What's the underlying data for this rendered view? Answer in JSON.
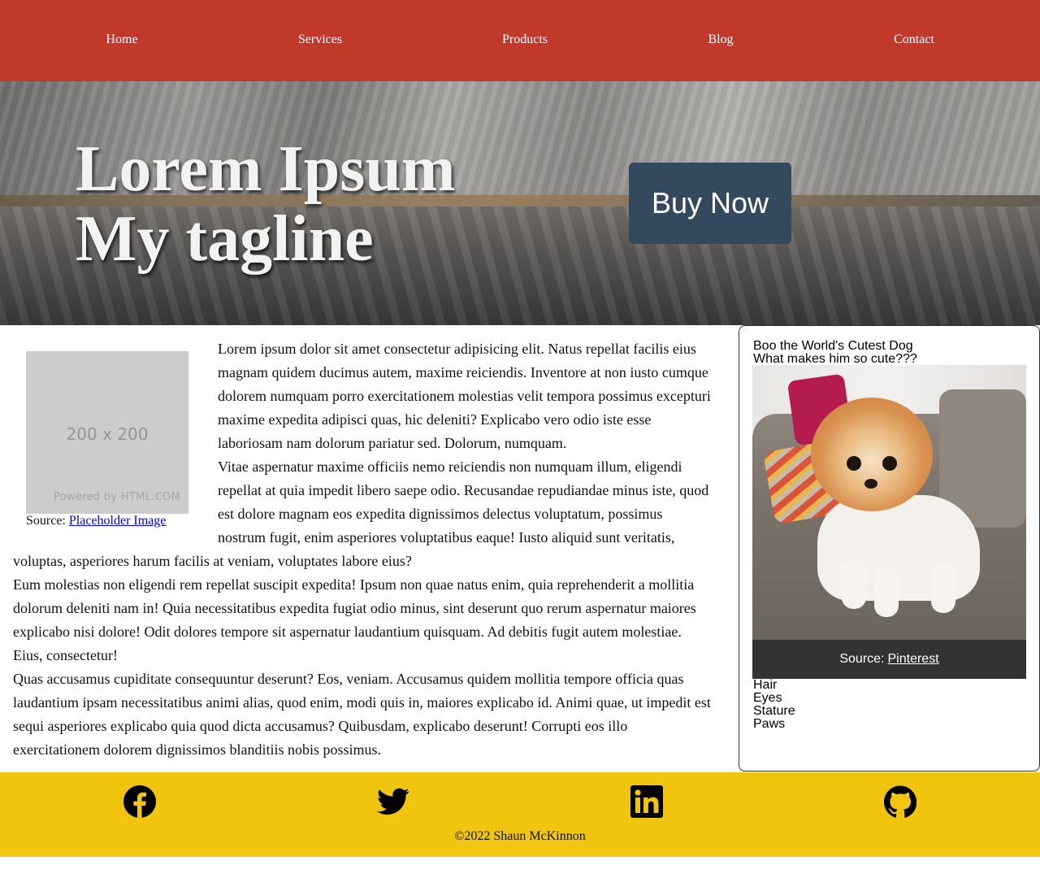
{
  "nav": {
    "items": [
      "Home",
      "Services",
      "Products",
      "Blog",
      "Contact"
    ]
  },
  "hero": {
    "title_line1": "Lorem Ipsum",
    "title_line2": "My tagline",
    "buy_button": "Buy Now"
  },
  "main": {
    "placeholder": {
      "size_text": "200 x 200",
      "powered_text": "Powered by HTML.COM",
      "caption_prefix": "Source:",
      "caption_link": "Placeholder Image"
    },
    "paragraphs": [
      "Lorem ipsum dolor sit amet consectetur adipisicing elit. Natus repellat facilis eius magnam quidem ducimus autem, maxime reiciendis. Inventore at non iusto cumque dolorem numquam porro exercitationem molestias velit tempora possimus excepturi maxime expedita adipisci quas, hic deleniti? Explicabo vero odio iste esse laboriosam nam dolorum pariatur sed. Dolorum, numquam.",
      "Vitae aspernatur maxime officiis nemo reiciendis non numquam illum, eligendi repellat at quia impedit libero saepe odio. Recusandae repudiandae minus iste, quod est dolore magnam eos expedita dignissimos delectus voluptatum, possimus nostrum fugit, enim asperiores voluptatibus eaque! Iusto aliquid sunt veritatis, voluptas, asperiores harum facilis at veniam, voluptates labore eius?",
      "Eum molestias non eligendi rem repellat suscipit expedita! Ipsum non quae natus enim, quia reprehenderit a mollitia dolorum deleniti nam in! Quia necessitatibus expedita fugiat odio minus, sint deserunt quo rerum aspernatur maiores explicabo nisi dolore! Odit dolores tempore sit aspernatur laudantium quisquam. Ad debitis fugit autem molestiae. Eius, consectetur!",
      "Quas accusamus cupiditate consequuntur deserunt? Eos, veniam. Accusamus quidem mollitia tempore officia quas laudantium ipsam necessitatibus animi alias, quod enim, modi quis in, maiores explicabo id. Animi quae, ut impedit est sequi asperiores explicabo quia quod dicta accusamus? Quibusdam, explicabo deserunt! Corrupti eos illo exercitationem dolorem dignissimos blanditiis nobis possimus."
    ]
  },
  "aside": {
    "title": "Boo the World's Cutest Dog",
    "subtitle": "What makes him so cute???",
    "caption_prefix": "Source:",
    "caption_link": "Pinterest",
    "list": [
      "Hair",
      "Eyes",
      "Stature",
      "Paws"
    ]
  },
  "footer": {
    "icons": [
      "facebook-icon",
      "twitter-icon",
      "linkedin-icon",
      "github-icon"
    ],
    "copyright": "©2022 Shaun McKinnon"
  },
  "colors": {
    "nav_bg": "#c0392b",
    "button_bg": "#34495e",
    "footer_bg": "#f1c40f",
    "caption_bg": "#333333"
  }
}
